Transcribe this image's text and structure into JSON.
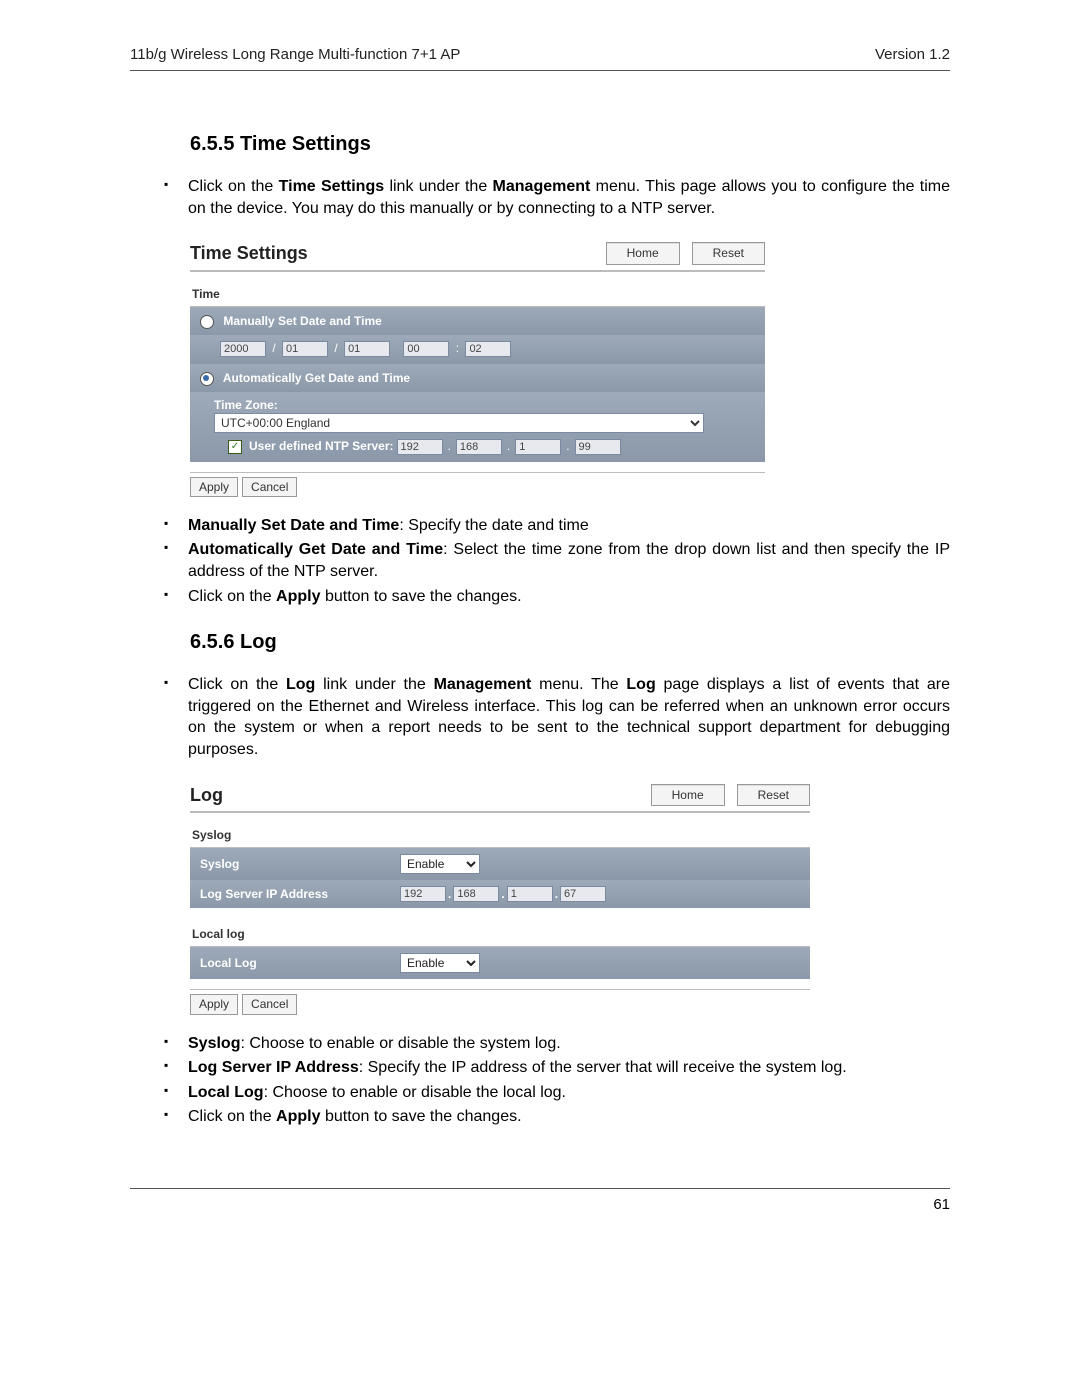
{
  "header": {
    "left": "11b/g Wireless Long Range Multi-function 7+1 AP",
    "right": "Version 1.2"
  },
  "section1": {
    "heading": "6.5.5  Time Settings",
    "intro_prefix": "Click on the ",
    "intro_b1": "Time Settings",
    "intro_mid": " link under the ",
    "intro_b2": "Management",
    "intro_suffix": " menu. This page allows you to configure the time on the device. You may do this manually or by connecting to a NTP server.",
    "panel": {
      "title": "Time Settings",
      "home": "Home",
      "reset": "Reset",
      "section_label": "Time",
      "manual_label": "Manually Set Date and Time",
      "auto_label": "Automatically Get Date and Time",
      "tz_label": "Time Zone:",
      "tz_value": "UTC+00:00 England",
      "ntp_label": "User defined NTP Server:",
      "date": {
        "year": "2000",
        "month": "01",
        "day": "01",
        "hour": "00",
        "min": "02"
      },
      "ntp": {
        "o1": "192",
        "o2": "168",
        "o3": "1",
        "o4": "99"
      },
      "apply": "Apply",
      "cancel": "Cancel"
    },
    "bullets": {
      "b1_bold": "Manually Set Date and Time",
      "b1_rest": ": Specify the date and time",
      "b2_bold": "Automatically Get Date and Time",
      "b2_rest": ": Select the time zone from the drop down list and then specify the IP address of the NTP server.",
      "b3_pre": "Click on the ",
      "b3_bold": "Apply",
      "b3_rest": " button to save the changes."
    }
  },
  "section2": {
    "heading": "6.5.6  Log",
    "intro_pre": "Click on the ",
    "intro_b1": "Log",
    "intro_mid1": " link under the ",
    "intro_b2": "Management",
    "intro_mid2": " menu. The ",
    "intro_b3": "Log",
    "intro_rest": " page displays a list of events that are triggered on the Ethernet and Wireless interface. This log can be referred when an unknown error occurs on the system or when a report needs to be sent to the technical support department for debugging purposes.",
    "panel": {
      "title": "Log",
      "home": "Home",
      "reset": "Reset",
      "syslog_section": "Syslog",
      "syslog_label": "Syslog",
      "syslog_value": "Enable",
      "logip_label": "Log Server IP Address",
      "ip": {
        "o1": "192",
        "o2": "168",
        "o3": "1",
        "o4": "67"
      },
      "locallog_section": "Local log",
      "locallog_label": "Local Log",
      "locallog_value": "Enable",
      "apply": "Apply",
      "cancel": "Cancel"
    },
    "bullets": {
      "b1_bold": "Syslog",
      "b1_rest": ": Choose to enable or disable the system log.",
      "b2_bold": "Log Server IP Address",
      "b2_rest": ": Specify the IP address of the server that will receive the system log.",
      "b3_bold": "Local Log",
      "b3_rest": ": Choose to enable or disable the local log.",
      "b4_pre": "Click on the ",
      "b4_bold": "Apply",
      "b4_rest": " button to save the changes."
    }
  },
  "footer": {
    "page": "61"
  }
}
